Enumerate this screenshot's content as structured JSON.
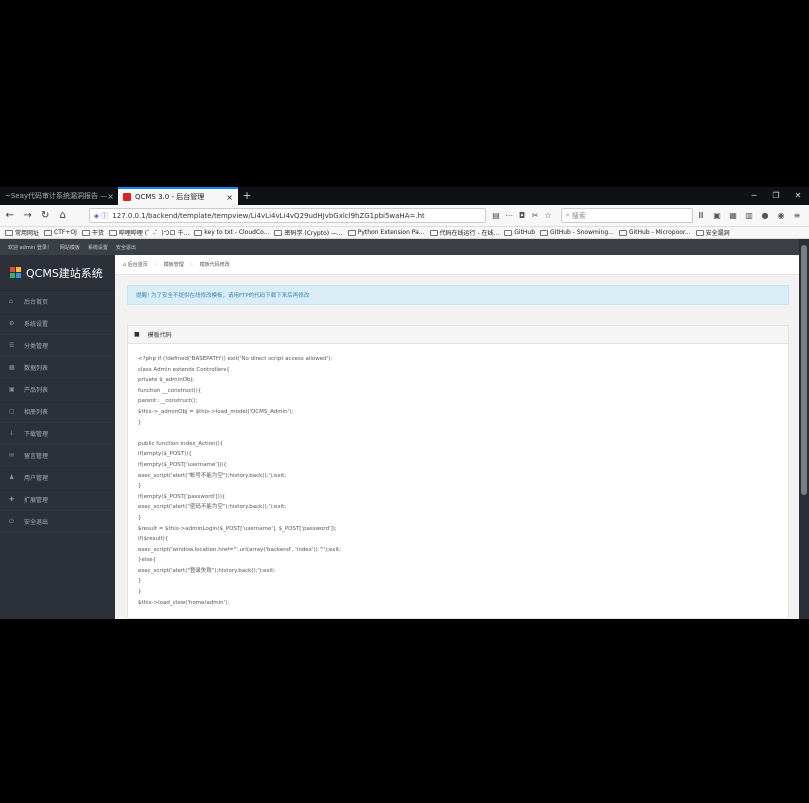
{
  "browser": {
    "tabs": [
      {
        "label": "~Seay代码审计系统漏洞报告 —",
        "active": false
      },
      {
        "label": "QCMS 3.0 - 后台管理",
        "active": true
      }
    ],
    "url": "127.0.0.1/backend/template/tempview/Li4vLi4vLi4vQ29udHJvbGxlcl9hZG1pbi5waHA=.ht",
    "search_placeholder": "搜索",
    "bookmarks": [
      "常用网址",
      "CTF+OJ",
      "干货",
      "哔哩哔哩 (゜-゜)つロ 千...",
      "key to txt - CloudCo...",
      "密码学 (Crypto) —...",
      "Python Extension Pa...",
      "代码在线运行 - 在线...",
      "GitHub",
      "GitHub - Snowming...",
      "GitHub - Micropoor...",
      "安全漏洞"
    ]
  },
  "admin": {
    "topbar": [
      "欢迎 admin 登录！",
      "网站模板",
      "系统设置",
      "安全退出"
    ],
    "logo": "QCMS建站系统",
    "menu": [
      "后台首页",
      "系统设置",
      "分类管理",
      "数据列表",
      "产品列表",
      "相册列表",
      "下载管理",
      "留言管理",
      "用户管理",
      "扩展管理",
      "安全退出"
    ],
    "breadcrumb": [
      "后台首页",
      "模板管理",
      "模板代码修改"
    ],
    "alert": "提醒! 为了安全不提供在线修改模板，请用FTP的代码下载下来后再修改",
    "panel_title": "模板代码",
    "code_lines": [
      "<?php if (!defined('BASEPATH')) exit('No direct script access allowed');",
      "class Admin extends Controllers{",
      "private $_adminObj;",
      "function __construct(){",
      "parent::__construct();",
      "$this->_adminObj = $this->load_model('QCMS_Admin');",
      "}",
      "",
      "public function index_Action(){",
      "if(empty($_POST)){",
      "if(empty($_POST['username'])){",
      "exec_script('alert(\"帐号不能为空\");history.back();');exit;",
      "}",
      "if(empty($_POST['password'])){",
      "exec_script('alert(\"密码不能为空\");history.back();');exit;",
      "}",
      "$result = $this->adminLogin($_POST['username'], $_POST['password']);",
      "if($result){",
      "exec_script('window.location.href=\"'.url(array('backend', 'index')).'\"');exit;",
      "}else{",
      "exec_script('alert(\"登录失败\");history.back();');exit;",
      "}",
      "}",
      "$this->load_view('home/admin');"
    ]
  },
  "colors": {
    "sidebar_bg": "#2c3038",
    "topbar_bg": "#3b3f47",
    "alert_bg": "#d9edf7",
    "alert_text": "#3a87ad",
    "logo_blocks": [
      "#e94b35",
      "#f6b93b",
      "#38b26b",
      "#3d8ee0"
    ]
  }
}
